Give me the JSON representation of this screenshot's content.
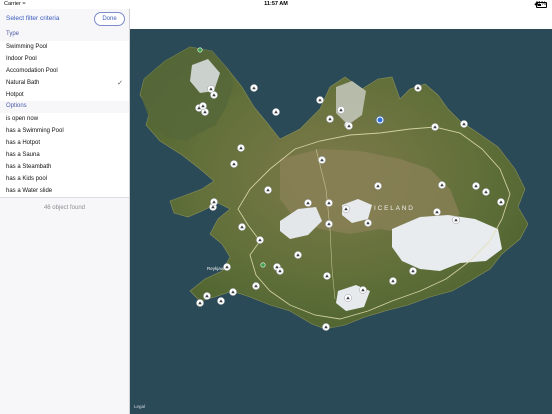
{
  "status_bar": {
    "carrier": "Carrier",
    "wifi": "≈",
    "time": "11:57 AM",
    "battery": "41%"
  },
  "sidebar": {
    "title": "Select filter criteria",
    "done_label": "Done",
    "type_header": "Type",
    "type_items": [
      {
        "label": "Swimming Pool",
        "checked": false
      },
      {
        "label": "Indoor Pool",
        "checked": false
      },
      {
        "label": "Accomodation Pool",
        "checked": false
      },
      {
        "label": "Natural Bath",
        "checked": true
      },
      {
        "label": "Hotpot",
        "checked": false
      }
    ],
    "options_header": "Options",
    "option_items": [
      {
        "label": "is open now"
      },
      {
        "label": "has a Swimming Pool"
      },
      {
        "label": "has a Hotpot"
      },
      {
        "label": "has a Sauna"
      },
      {
        "label": "has a Steambath"
      },
      {
        "label": "has a Kids pool"
      },
      {
        "label": "has a Water slide"
      }
    ],
    "checkmark": "✓",
    "count_text": "46 object found"
  },
  "map": {
    "region_label": "ICELAND",
    "city_label": "Reykjavík",
    "legal_label": "Legal",
    "water_color": "#2b4a57",
    "land_color": "#6f7a3f",
    "glacier_color": "#e4e8ea",
    "marker_icon": "pool-pin-icon",
    "user_location_icon": "user-location-icon",
    "user_location_color": "#2f6fe0",
    "poi_count": 50
  }
}
